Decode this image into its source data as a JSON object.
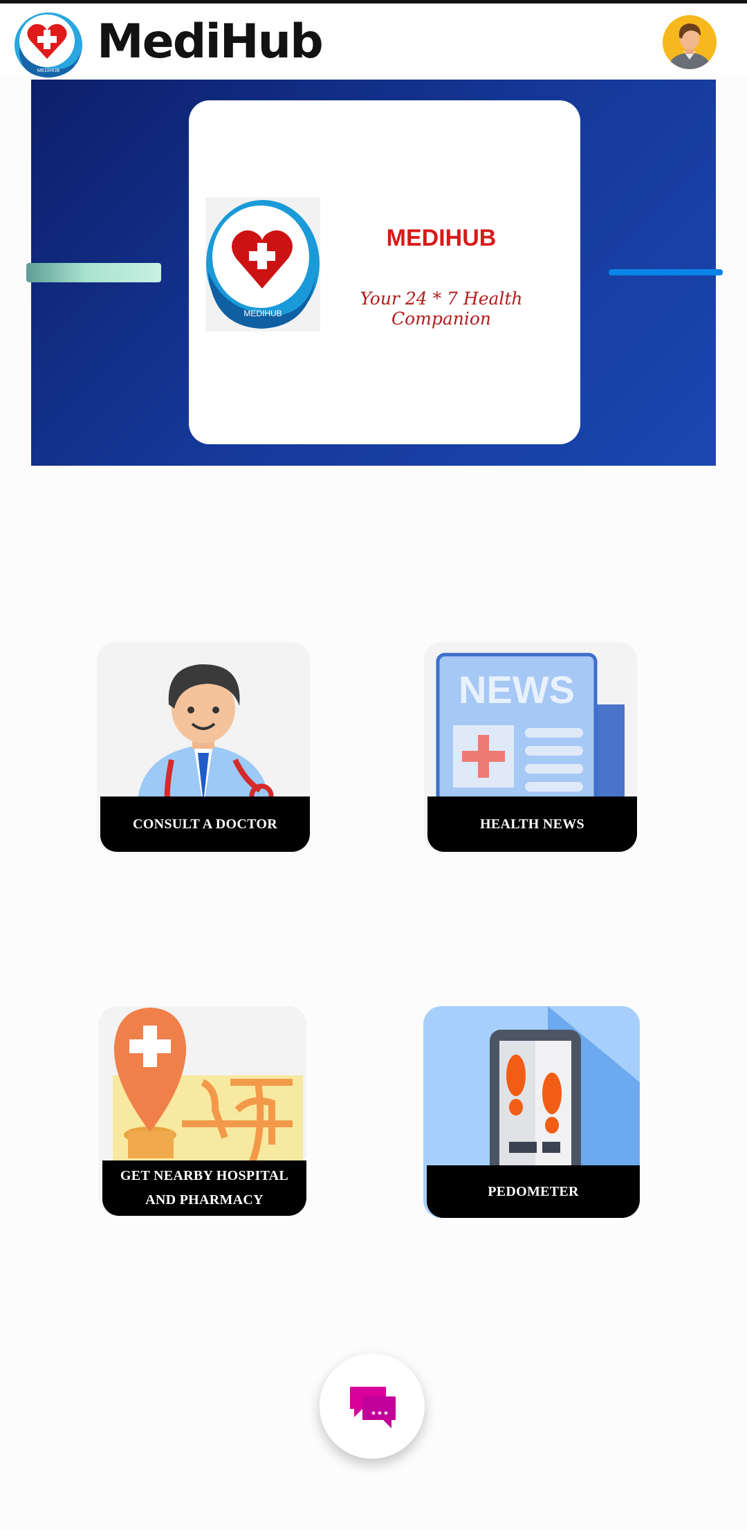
{
  "header": {
    "app_title": "MediHub",
    "logo_text": "MEDIHUB",
    "icons": {
      "logo": "medihub-heart-logo",
      "avatar": "user-avatar"
    }
  },
  "banner": {
    "title": "MEDIHUB",
    "tagline": "Your 24 * 7 Health Companion",
    "logo_text": "MEDIHUB"
  },
  "tiles": [
    {
      "label": "CONSULT A DOCTOR",
      "icon": "doctor-icon"
    },
    {
      "label": "HEALTH NEWS",
      "icon": "news-icon"
    },
    {
      "label": "GET NEARBY HOSPITAL AND PHARMACY",
      "line1": "GET NEARBY HOSPITAL",
      "line2": "AND PHARMACY",
      "icon": "map-pin-icon"
    },
    {
      "label": "PEDOMETER",
      "icon": "pedometer-icon"
    }
  ],
  "fab": {
    "icon": "chat-bubbles-icon"
  },
  "colors": {
    "banner": "#163a9c",
    "brand_red": "#d61a1a",
    "chat": "#d8009a",
    "tile_label_bg": "#000000"
  }
}
